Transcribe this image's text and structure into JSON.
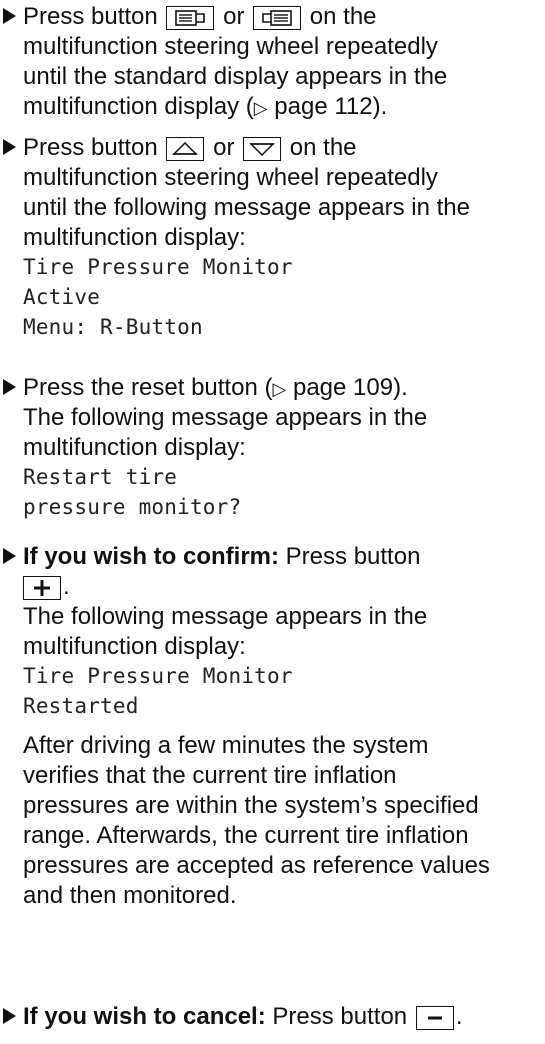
{
  "steps": [
    {
      "lines": [
        {
          "pre": "Press button",
          "icon1": "menu-back-icon",
          "mid": "or",
          "icon2": "menu-forward-icon",
          "post": "on the"
        },
        "multifunction steering wheel repeatedly",
        "until the standard display appears in the",
        "multifunction display (",
        "page 112)."
      ]
    },
    {
      "lines": [
        {
          "pre": "Press button",
          "icon1": "arrow-up-icon",
          "mid": "or",
          "icon2": "arrow-down-icon",
          "post": "on the"
        },
        "multifunction steering wheel repeatedly",
        "until the following message appears in the",
        "multifunction display:"
      ],
      "display": [
        "Tire Pressure Monitor",
        "Active",
        "Menu: R-Button"
      ]
    },
    {
      "lines": [
        "Press the reset button (",
        "page 109).",
        "The following message appears in the",
        "multifunction display:"
      ],
      "display": [
        "Restart tire",
        "pressure monitor?"
      ]
    },
    {
      "bold": "If you wish to confirm:",
      "lines": [
        "Press button",
        "The following message appears in the",
        "multifunction display:"
      ],
      "key_icon": "plus-icon",
      "display": [
        "Tire Pressure Monitor",
        "Restarted"
      ],
      "paragraph": [
        "After driving a few minutes the system",
        "verifies that the current tire inflation",
        "pressures are within the system’s specified",
        "range. Afterwards, the current tire inflation",
        "pressures are accepted as reference values",
        "and then monitored."
      ]
    },
    {
      "bold": "If you wish to cancel:",
      "lines": [
        "Press button"
      ],
      "key_icon": "minus-icon"
    }
  ]
}
